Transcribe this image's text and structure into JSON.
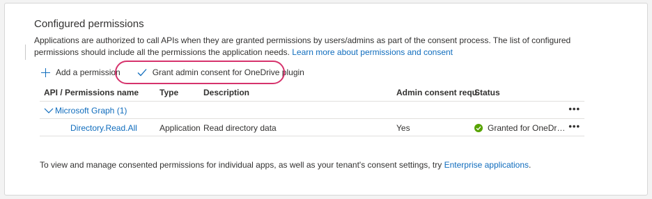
{
  "section": {
    "title": "Configured permissions",
    "description": "Applications are authorized to call APIs when they are granted permissions by users/admins as part of the consent process. The list of configured permissions should include all the permissions the application needs.",
    "learn_more_link": "Learn more about permissions and consent"
  },
  "toolbar": {
    "add_label": "Add a permission",
    "grant_label": "Grant admin consent for OneDrive plugin"
  },
  "table": {
    "headers": {
      "api": "API / Permissions name",
      "type": "Type",
      "description": "Description",
      "admin_consent": "Admin consent requ...",
      "status": "Status"
    },
    "group": {
      "name": "Microsoft Graph (1)",
      "more": "•••"
    },
    "rows": [
      {
        "name": "Directory.Read.All",
        "type": "Application",
        "description": "Read directory data",
        "admin_consent": "Yes",
        "status": "Granted for OneDrive plugin",
        "more": "•••"
      }
    ]
  },
  "footer": {
    "text": "To view and manage consented permissions for individual apps, as well as your tenant's consent settings, try",
    "link": "Enterprise applications",
    "end": "."
  },
  "colors": {
    "accent": "#0f6cbd",
    "highlight": "#d6336c",
    "success": "#57a300"
  }
}
